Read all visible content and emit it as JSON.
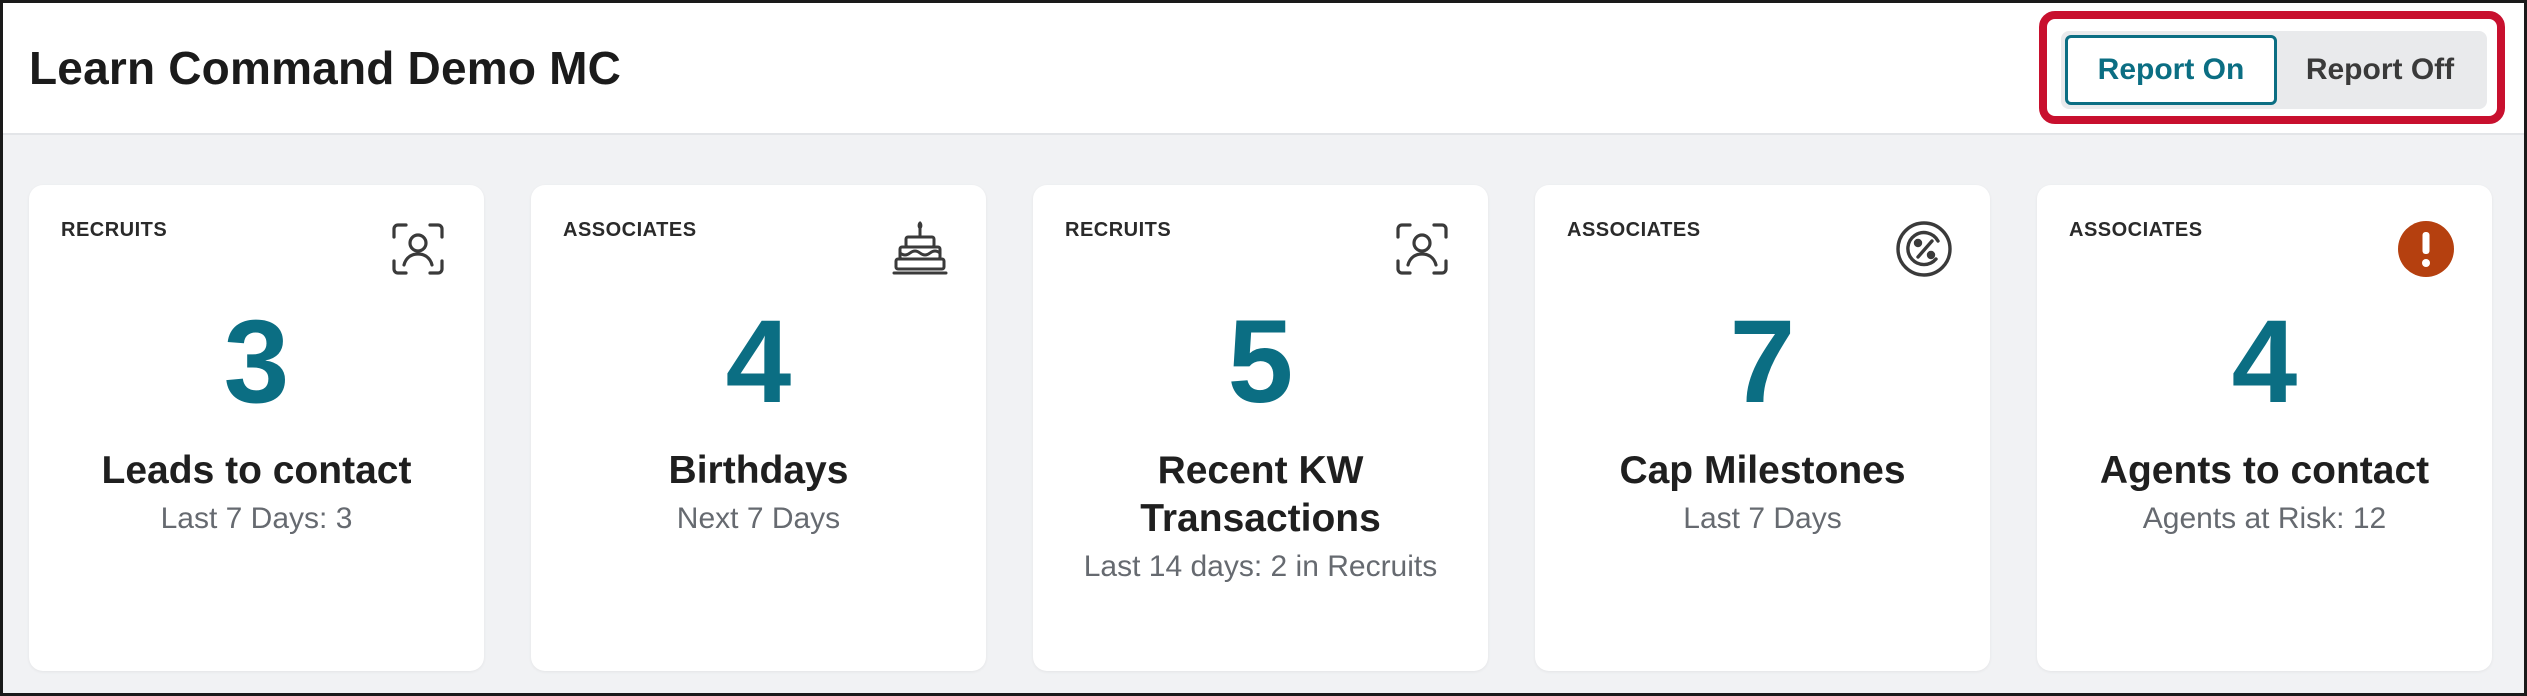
{
  "header": {
    "title": "Learn Command Demo MC",
    "report_on_label": "Report On",
    "report_off_label": "Report Off"
  },
  "cards": [
    {
      "category": "RECRUITS",
      "icon": "person-frame-icon",
      "count": "3",
      "title": "Leads to contact",
      "subtitle": "Last 7 Days: 3"
    },
    {
      "category": "ASSOCIATES",
      "icon": "birthday-cake-icon",
      "count": "4",
      "title": "Birthdays",
      "subtitle": "Next 7 Days"
    },
    {
      "category": "RECRUITS",
      "icon": "person-frame-icon",
      "count": "5",
      "title": "Recent KW Transactions",
      "subtitle": "Last 14 days: 2 in Recruits"
    },
    {
      "category": "ASSOCIATES",
      "icon": "cap-percent-icon",
      "count": "7",
      "title": "Cap Milestones",
      "subtitle": "Last 7 Days"
    },
    {
      "category": "ASSOCIATES",
      "icon": "alert-exclamation-icon",
      "count": "4",
      "title": "Agents to contact",
      "subtitle": "Agents at Risk: 12"
    }
  ],
  "colors": {
    "accent": "#0b6e83",
    "highlight": "#c8102e",
    "alert": "#b5400f"
  }
}
